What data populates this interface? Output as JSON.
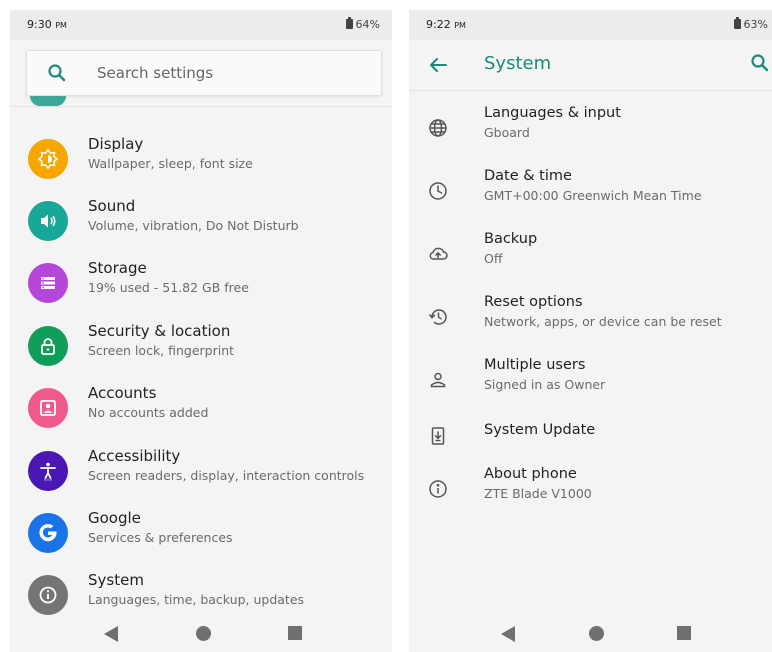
{
  "left": {
    "status": {
      "time": "9:30",
      "ampm": "PM",
      "battery": "64%"
    },
    "search": {
      "placeholder": "Search settings"
    },
    "items": [
      {
        "title": "Display",
        "subtitle": "Wallpaper, sleep, font size",
        "icon": "display-icon",
        "color": "#f7a600"
      },
      {
        "title": "Sound",
        "subtitle": "Volume, vibration, Do Not Disturb",
        "icon": "sound-icon",
        "color": "#17a796"
      },
      {
        "title": "Storage",
        "subtitle": "19% used - 51.82 GB free",
        "icon": "storage-icon",
        "color": "#b546d8"
      },
      {
        "title": "Security & location",
        "subtitle": "Screen lock, fingerprint",
        "icon": "lock-icon",
        "color": "#0f9d58"
      },
      {
        "title": "Accounts",
        "subtitle": "No accounts added",
        "icon": "accounts-icon",
        "color": "#ef5a8a"
      },
      {
        "title": "Accessibility",
        "subtitle": "Screen readers, display, interaction controls",
        "icon": "accessibility-icon",
        "color": "#4b17b4"
      },
      {
        "title": "Google",
        "subtitle": "Services & preferences",
        "icon": "google-icon",
        "color": "#1a73e8"
      },
      {
        "title": "System",
        "subtitle": "Languages, time, backup, updates",
        "icon": "system-info-icon",
        "color": "#757575"
      }
    ]
  },
  "right": {
    "status": {
      "time": "9:22",
      "ampm": "PM",
      "battery": "63%"
    },
    "appbar": {
      "title": "System"
    },
    "accent": "#1b8a7a",
    "items": [
      {
        "title": "Languages & input",
        "subtitle": "Gboard",
        "icon": "globe-icon"
      },
      {
        "title": "Date & time",
        "subtitle": "GMT+00:00 Greenwich Mean Time",
        "icon": "clock-icon"
      },
      {
        "title": "Backup",
        "subtitle": "Off",
        "icon": "cloud-upload-icon"
      },
      {
        "title": "Reset options",
        "subtitle": "Network, apps, or device can be reset",
        "icon": "history-icon"
      },
      {
        "title": "Multiple users",
        "subtitle": "Signed in as Owner",
        "icon": "person-icon"
      },
      {
        "title": "System Update",
        "subtitle": "",
        "icon": "system-update-icon"
      },
      {
        "title": "About phone",
        "subtitle": "ZTE Blade V1000",
        "icon": "info-icon"
      }
    ]
  }
}
